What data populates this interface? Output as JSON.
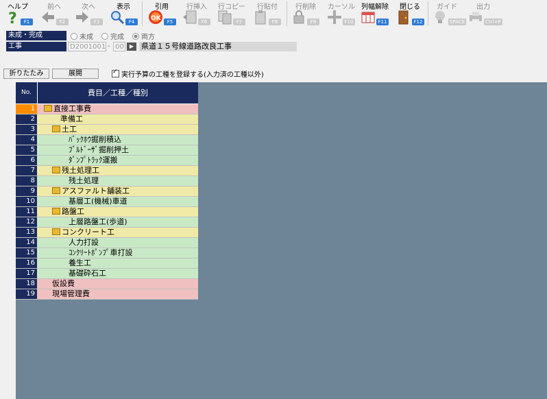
{
  "toolbar": {
    "help": {
      "label": "ヘルプ",
      "key": "F1"
    },
    "prev": {
      "label": "前へ",
      "key": "F2"
    },
    "next": {
      "label": "次へ",
      "key": "F3"
    },
    "show": {
      "label": "表示",
      "key": "F4"
    },
    "quote": {
      "label": "引用",
      "key": "F5"
    },
    "insert": {
      "label": "行挿入",
      "key": "F6"
    },
    "copy": {
      "label": "行コピー",
      "key": "F7"
    },
    "paste": {
      "label": "行貼付",
      "key": "F8"
    },
    "delete": {
      "label": "行削除",
      "key": "F9"
    },
    "cursor": {
      "label": "カーソル",
      "key": "F10"
    },
    "colreset": {
      "label": "列幅解除",
      "key": "F11"
    },
    "close": {
      "label": "閉じる",
      "key": "F12"
    },
    "guide": {
      "label": "ガイド",
      "key": "SPACE"
    },
    "output": {
      "label": "出力",
      "key": "Ctrl+P"
    }
  },
  "status": {
    "label": "未成・完成",
    "options": [
      "未成",
      "完成",
      "両方"
    ],
    "selected": "両方"
  },
  "project": {
    "label": "工事",
    "code": "D2001001",
    "sep": "-",
    "sub": "00",
    "go": "▶",
    "name": "県道１５号線道路改良工事"
  },
  "actions": {
    "collapse": "折りたたみ",
    "expand": "展開",
    "register": "実行予算の工種を登録する(入力済の工種以外)"
  },
  "tree": {
    "col_no": "No.",
    "col_name": "費目／工種／種別",
    "rows": [
      {
        "no": "1",
        "name": "直接工事費",
        "indent": 0,
        "folder": true,
        "color": "red",
        "selected": true
      },
      {
        "no": "2",
        "name": "準備工",
        "indent": 1,
        "folder": false,
        "color": "yel"
      },
      {
        "no": "3",
        "name": "土工",
        "indent": 1,
        "folder": true,
        "color": "yel"
      },
      {
        "no": "4",
        "name": "ﾊﾞｯｸﾎｳ掘削積込",
        "indent": 2,
        "folder": false,
        "color": "grn"
      },
      {
        "no": "5",
        "name": "ﾌﾞﾙﾄﾞｰｻﾞ掘削押土",
        "indent": 2,
        "folder": false,
        "color": "grn"
      },
      {
        "no": "6",
        "name": "ﾀﾞﾝﾌﾟﾄﾗｯｸ運搬",
        "indent": 2,
        "folder": false,
        "color": "grn"
      },
      {
        "no": "7",
        "name": "残土処理工",
        "indent": 1,
        "folder": true,
        "color": "yel"
      },
      {
        "no": "8",
        "name": "残土処理",
        "indent": 2,
        "folder": false,
        "color": "grn"
      },
      {
        "no": "9",
        "name": "アスファルト舗装工",
        "indent": 1,
        "folder": true,
        "color": "yel"
      },
      {
        "no": "10",
        "name": "基層工(機械)車道",
        "indent": 2,
        "folder": false,
        "color": "grn"
      },
      {
        "no": "11",
        "name": "路盤工",
        "indent": 1,
        "folder": true,
        "color": "yel"
      },
      {
        "no": "12",
        "name": "上層路盤工(歩道)",
        "indent": 2,
        "folder": false,
        "color": "grn"
      },
      {
        "no": "13",
        "name": "コンクリート工",
        "indent": 1,
        "folder": true,
        "color": "yel"
      },
      {
        "no": "14",
        "name": "人力打設",
        "indent": 2,
        "folder": false,
        "color": "grn"
      },
      {
        "no": "15",
        "name": "ｺﾝｸﾘｰﾄﾎﾟﾝﾌﾟ車打設",
        "indent": 2,
        "folder": false,
        "color": "grn"
      },
      {
        "no": "16",
        "name": "養生工",
        "indent": 2,
        "folder": false,
        "color": "grn"
      },
      {
        "no": "17",
        "name": "基礎砕石工",
        "indent": 2,
        "folder": false,
        "color": "grn"
      },
      {
        "no": "18",
        "name": "仮設費",
        "indent": 0,
        "folder": false,
        "color": "red"
      },
      {
        "no": "19",
        "name": "現場管理費",
        "indent": 0,
        "folder": false,
        "color": "red"
      }
    ]
  },
  "colors": {
    "navy": "#1a2a5c",
    "bg": "#6e8497",
    "selected": "#ff8c00"
  },
  "icons": [
    "question-icon",
    "arrow-left-icon",
    "arrow-right-icon",
    "magnifier-icon",
    "ok-icon",
    "insert-row-icon",
    "copy-row-icon",
    "paste-row-icon",
    "lock-icon",
    "cursor-icon",
    "column-reset-icon",
    "door-icon",
    "lightbulb-icon",
    "printer-icon"
  ]
}
